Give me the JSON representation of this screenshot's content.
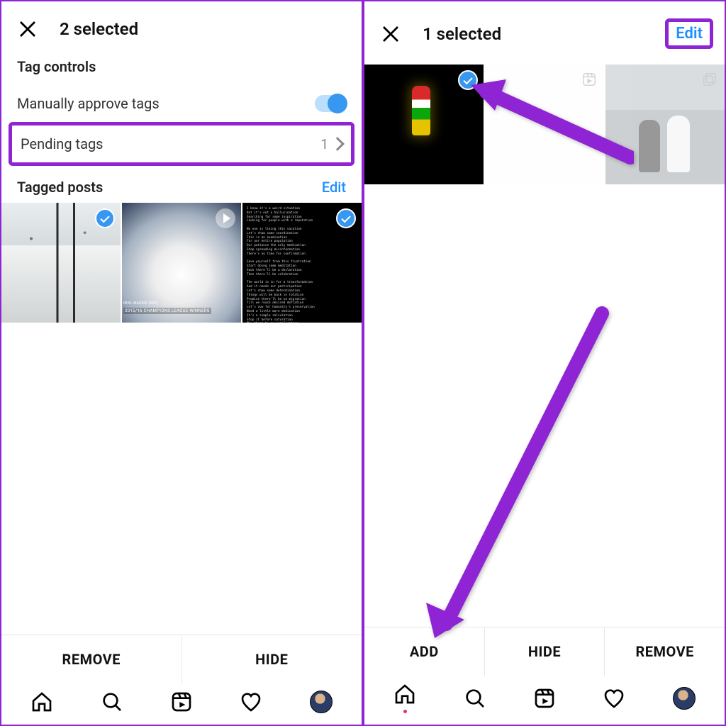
{
  "left": {
    "header_title": "2 selected",
    "tag_controls_label": "Tag controls",
    "manually_approve_label": "Manually approve tags",
    "manually_approve_on": true,
    "pending_tags_label": "Pending tags",
    "pending_tags_count": "1",
    "tagged_posts_label": "Tagged posts",
    "edit_label": "Edit",
    "thumbs": [
      {
        "name": "snow-street",
        "selected": true,
        "badge": "check"
      },
      {
        "name": "smoke-stadium",
        "selected": false,
        "badge": "play",
        "caption_small": "REAL MADRID (ESP)",
        "caption_small2": "2015/16 CHAMPIONS LEAGUE WINNERS"
      },
      {
        "name": "poem-text",
        "selected": true,
        "badge": "check"
      }
    ],
    "poem_text": "I know it's a weird situation\nBut it's not a hallucination\nSearching for some inspiration\nLooking for people with a reputation\n\nNo one is liking this vacation\nLet's show some coordination\nThis is an examination\nFor our entire population\nOur patience the only medication\nStop spreading misinformation\nThere's no time for confirmation\n\nSave yourself from this frustration\nStart doing some meditation\nSoon there'll be a declaration\nThen there'll be celebration\n\nThe world is in for a transformation\nAnd it needs our participation\nLet's show some determination\nThings will be back in rotation\nPromise there'll be no migration\nTill we reach desired deflation\nLet's vow for humanity's preservation\nNeed a little more dedication\nIt's a simple calculation\nStop it before saturation\nMay there be no complication\n\nThis song is a small donation\nWait you need proof or validation?\nOh yes this is my creation\nBut please don't think of duplication",
    "actions": {
      "remove": "REMOVE",
      "hide": "HIDE"
    }
  },
  "right": {
    "header_title": "1 selected",
    "edit_label": "Edit",
    "thumbs": [
      {
        "name": "night-figure",
        "selected": true,
        "badge": "check"
      },
      {
        "name": "blank-reel",
        "selected": false,
        "badge": "reel",
        "dimmed": true
      },
      {
        "name": "couple-bridge",
        "selected": false,
        "badge": "multi",
        "dimmed": true
      }
    ],
    "actions": {
      "add": "ADD",
      "hide": "HIDE",
      "remove": "REMOVE"
    }
  },
  "nav_icons": [
    "home",
    "search",
    "reels",
    "activity",
    "profile"
  ]
}
